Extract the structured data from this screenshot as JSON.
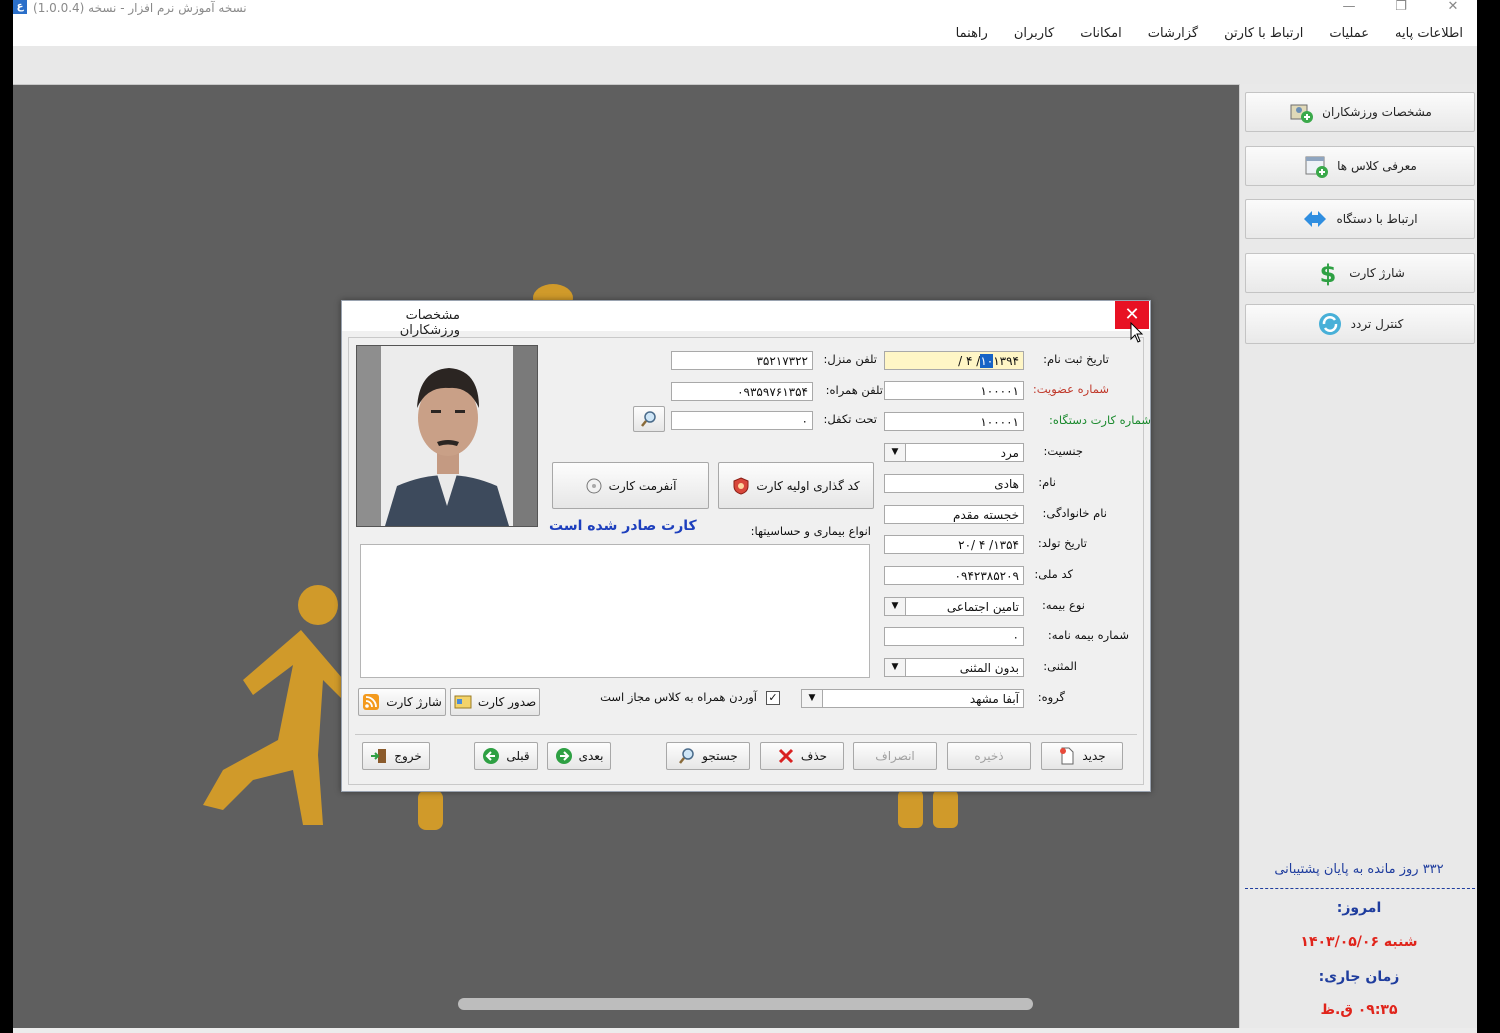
{
  "window": {
    "title": "نسخه آموزش نرم افزار - نسخه (1.0.0.4)",
    "icon": "app-logo-icon"
  },
  "menu": [
    "اطلاعات پایه",
    "عملیات",
    "ارتباط با کارتن",
    "گزارشات",
    "امکانات",
    "کاربران",
    "راهنما"
  ],
  "sidebar": {
    "buttons": [
      {
        "label": "مشخصات ورزشکاران",
        "icon": "athletes-icon"
      },
      {
        "label": "معرفی کلاس ها",
        "icon": "calendar-add-icon"
      },
      {
        "label": "ارتباط با دستگاه",
        "icon": "arrows-icon"
      },
      {
        "label": "شارژ کارت",
        "icon": "dollar-icon"
      },
      {
        "label": "کنترل تردد",
        "icon": "refresh-icon"
      }
    ],
    "support_remaining": "۳۳۲ روز مانده به پایان پشتیبانی",
    "today_label": "امروز:",
    "today_value": "شنبه ۱۴۰۳/۰۵/۰۶",
    "time_label": "زمان جاری:",
    "time_value": "۰۹:۳۵ ق.ظ",
    "colors": {
      "label": "#1f3d9e",
      "value": "#e0241b"
    }
  },
  "dialog": {
    "title": "مشخصات ورزشکاران",
    "close": "✕",
    "fields": {
      "reg_date": {
        "label": "تاریخ ثبت نام:",
        "value_main": "۱۳۹۴/ ۴ /",
        "value_sel": "۱۰"
      },
      "member_no": {
        "label": "شماره عضویت:",
        "value": "۱۰۰۰۰۱"
      },
      "device_card": {
        "label": "شماره کارت دستگاه:",
        "value": "۱۰۰۰۰۱"
      },
      "gender": {
        "label": "جنسیت:",
        "value": "مرد"
      },
      "first_name": {
        "label": "نام:",
        "value": "هادی"
      },
      "last_name": {
        "label": "نام خانوادگی:",
        "value": "خجسته مقدم"
      },
      "birth_date": {
        "label": "تاریخ تولد:",
        "value": "۱۳۵۴/ ۴ /۲۰"
      },
      "national_id": {
        "label": "کد ملی:",
        "value": "۰۹۴۲۳۸۵۲۰۹"
      },
      "insurance_type": {
        "label": "نوع بیمه:",
        "value": "تامین اجتماعی"
      },
      "insurance_no": {
        "label": "شماره بیمه نامه:",
        "value": "۰"
      },
      "replacement": {
        "label": "المثنی:",
        "value": "بدون المثنی"
      },
      "group": {
        "label": "گروه:",
        "value": "آبفا مشهد"
      },
      "home_phone": {
        "label": "تلفن منزل:",
        "value": "۳۵۲۱۷۳۲۲"
      },
      "mobile": {
        "label": "تلفن همراه:",
        "value": "۰۹۳۵۹۷۶۱۳۵۴"
      },
      "dependents": {
        "label": "تحت تکفل:",
        "value": "۰"
      }
    },
    "card_buttons": {
      "init_code": "کد گذاری اولیه کارت",
      "unformat": "آنفرمت کارت"
    },
    "card_status": "کارت صادر شده است",
    "diseases_label": "انواع بیماری و حساسیتها:",
    "companion_label": "آوردن همراه به کلاس مجاز است",
    "companion_checked": "✓",
    "issue_card": "صدور کارت",
    "charge_card": "شارژ کارت",
    "actions": {
      "new": "جدید",
      "save": "ذخیره",
      "cancel": "انصراف",
      "delete": "حذف",
      "search": "جستجو",
      "next": "بعدی",
      "prev": "قبلی",
      "exit": "خروج"
    }
  }
}
